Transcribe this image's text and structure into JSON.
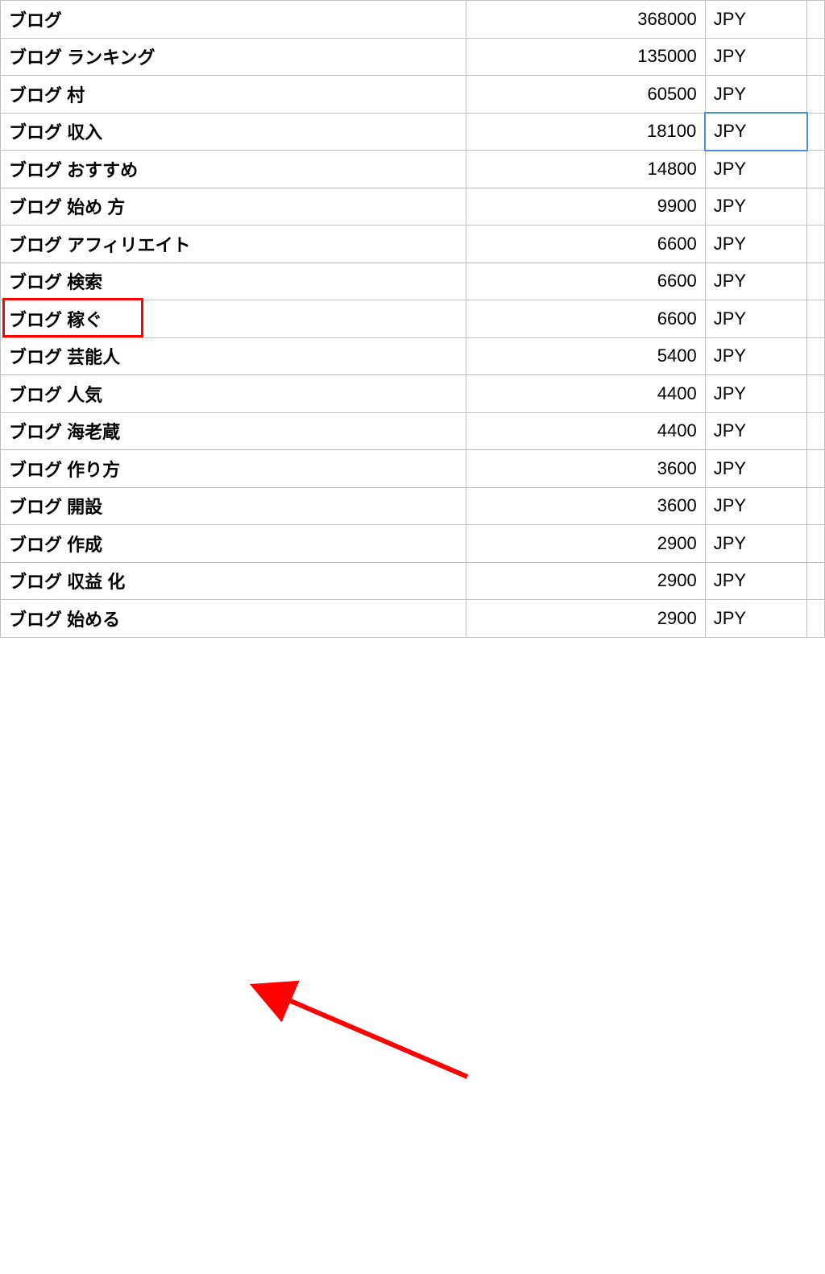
{
  "rows": [
    {
      "keyword": "ブログ",
      "volume": "368000",
      "currency": "JPY"
    },
    {
      "keyword": "ブログ ランキング",
      "volume": "135000",
      "currency": "JPY"
    },
    {
      "keyword": "ブログ 村",
      "volume": "60500",
      "currency": "JPY"
    },
    {
      "keyword": "ブログ 収入",
      "volume": "18100",
      "currency": "JPY",
      "selected_currency": true
    },
    {
      "keyword": "ブログ おすすめ",
      "volume": "14800",
      "currency": "JPY"
    },
    {
      "keyword": "ブログ 始め 方",
      "volume": "9900",
      "currency": "JPY"
    },
    {
      "keyword": "ブログ アフィリエイト",
      "volume": "6600",
      "currency": "JPY"
    },
    {
      "keyword": "ブログ 検索",
      "volume": "6600",
      "currency": "JPY"
    },
    {
      "keyword": "ブログ 稼ぐ",
      "volume": "6600",
      "currency": "JPY",
      "highlighted": true
    },
    {
      "keyword": "ブログ 芸能人",
      "volume": "5400",
      "currency": "JPY"
    },
    {
      "keyword": "ブログ 人気",
      "volume": "4400",
      "currency": "JPY"
    },
    {
      "keyword": "ブログ 海老蔵",
      "volume": "4400",
      "currency": "JPY"
    },
    {
      "keyword": "ブログ 作り方",
      "volume": "3600",
      "currency": "JPY"
    },
    {
      "keyword": "ブログ 開設",
      "volume": "3600",
      "currency": "JPY"
    },
    {
      "keyword": "ブログ 作成",
      "volume": "2900",
      "currency": "JPY"
    },
    {
      "keyword": "ブログ 収益 化",
      "volume": "2900",
      "currency": "JPY"
    },
    {
      "keyword": "ブログ 始める",
      "volume": "2900",
      "currency": "JPY"
    }
  ],
  "annotations": {
    "red_box": {
      "row_index": 8
    },
    "arrow": {
      "from_row": 11,
      "to_row": 8
    }
  }
}
